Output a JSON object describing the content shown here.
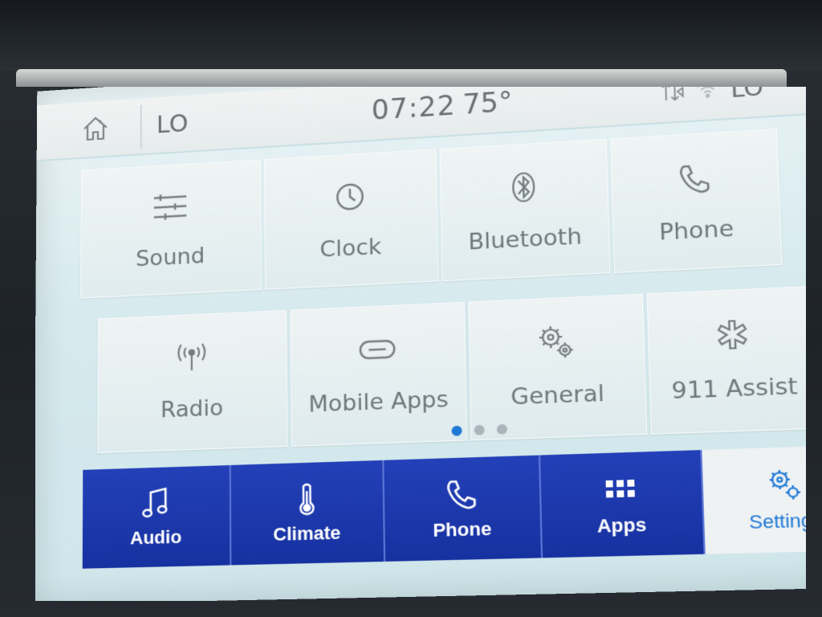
{
  "status_bar": {
    "left_temp": "LO",
    "time": "07:22",
    "outside_temp": "75°",
    "right_temp": "LO",
    "icons": [
      "home-icon",
      "data-signal-icon",
      "wifi-icon"
    ]
  },
  "tiles": [
    {
      "label": "Sound",
      "icon": "sliders-icon"
    },
    {
      "label": "Clock",
      "icon": "clock-icon"
    },
    {
      "label": "Bluetooth",
      "icon": "bluetooth-icon"
    },
    {
      "label": "Phone",
      "icon": "phone-icon"
    },
    {
      "label": "Radio",
      "icon": "antenna-icon"
    },
    {
      "label": "Mobile Apps",
      "icon": "link-icon"
    },
    {
      "label": "General",
      "icon": "gears-icon"
    },
    {
      "label": "911 Assist",
      "icon": "asterisk-icon"
    }
  ],
  "pagination": {
    "pages": 3,
    "current": 1
  },
  "nav": [
    {
      "label": "Audio",
      "icon": "music-note-icon"
    },
    {
      "label": "Climate",
      "icon": "thermometer-icon"
    },
    {
      "label": "Phone",
      "icon": "phone-icon"
    },
    {
      "label": "Apps",
      "icon": "grid-icon"
    },
    {
      "label": "Settings",
      "icon": "gears-icon",
      "selected": true
    }
  ],
  "colors": {
    "nav_blue": "#1f3cb4",
    "accent_blue": "#1e78d6",
    "screen_bg": "#dcecef"
  }
}
